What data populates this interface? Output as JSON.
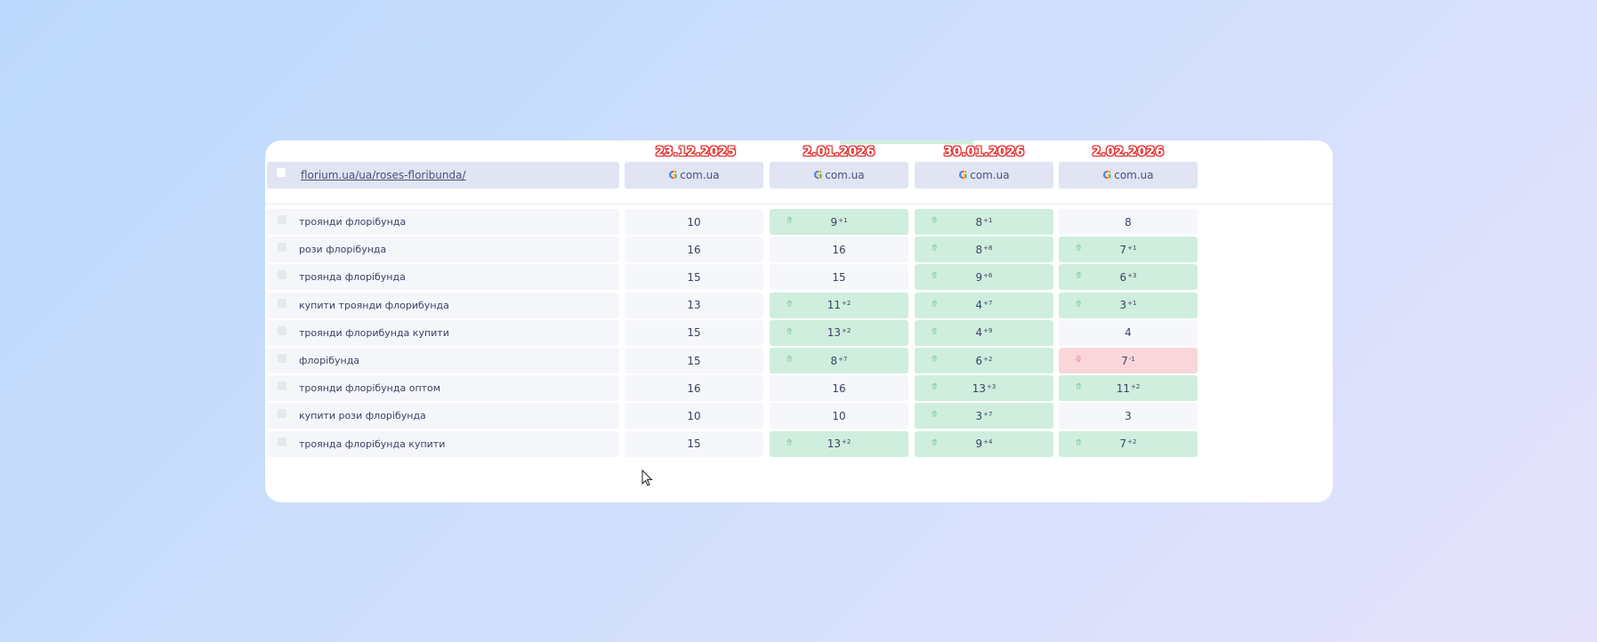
{
  "header": {
    "url": "florium.ua/ua/roses-floribunda/",
    "engine_label": "com.ua",
    "engine_icon": "google-icon"
  },
  "dates": [
    "23.12.2025",
    "2.01.2026",
    "30.01.2026",
    "2.02.2026"
  ],
  "columns": 4,
  "rows": [
    {
      "keyword": "троянди флорібунда",
      "cells": [
        {
          "value": "10",
          "delta": "",
          "trend": "none"
        },
        {
          "value": "9",
          "delta": "+1",
          "trend": "up"
        },
        {
          "value": "8",
          "delta": "+1",
          "trend": "up"
        },
        {
          "value": "8",
          "delta": "",
          "trend": "none"
        }
      ]
    },
    {
      "keyword": "рози флорібунда",
      "cells": [
        {
          "value": "16",
          "delta": "",
          "trend": "none"
        },
        {
          "value": "16",
          "delta": "",
          "trend": "none"
        },
        {
          "value": "8",
          "delta": "+8",
          "trend": "up"
        },
        {
          "value": "7",
          "delta": "+1",
          "trend": "up"
        }
      ]
    },
    {
      "keyword": "троянда флорібунда",
      "cells": [
        {
          "value": "15",
          "delta": "",
          "trend": "none"
        },
        {
          "value": "15",
          "delta": "",
          "trend": "none"
        },
        {
          "value": "9",
          "delta": "+6",
          "trend": "up"
        },
        {
          "value": "6",
          "delta": "+3",
          "trend": "up"
        }
      ]
    },
    {
      "keyword": "купити троянди флорибунда",
      "cells": [
        {
          "value": "13",
          "delta": "",
          "trend": "none"
        },
        {
          "value": "11",
          "delta": "+2",
          "trend": "up"
        },
        {
          "value": "4",
          "delta": "+7",
          "trend": "up"
        },
        {
          "value": "3",
          "delta": "+1",
          "trend": "up"
        }
      ]
    },
    {
      "keyword": "троянди флорибунда купити",
      "cells": [
        {
          "value": "15",
          "delta": "",
          "trend": "none"
        },
        {
          "value": "13",
          "delta": "+2",
          "trend": "up"
        },
        {
          "value": "4",
          "delta": "+9",
          "trend": "up"
        },
        {
          "value": "4",
          "delta": "",
          "trend": "none"
        }
      ]
    },
    {
      "keyword": "флорібунда",
      "cells": [
        {
          "value": "15",
          "delta": "",
          "trend": "none"
        },
        {
          "value": "8",
          "delta": "+7",
          "trend": "up"
        },
        {
          "value": "6",
          "delta": "+2",
          "trend": "up"
        },
        {
          "value": "7",
          "delta": "-1",
          "trend": "down"
        }
      ]
    },
    {
      "keyword": "троянди флорібунда оптом",
      "cells": [
        {
          "value": "16",
          "delta": "",
          "trend": "none"
        },
        {
          "value": "16",
          "delta": "",
          "trend": "none"
        },
        {
          "value": "13",
          "delta": "+3",
          "trend": "up"
        },
        {
          "value": "11",
          "delta": "+2",
          "trend": "up"
        }
      ]
    },
    {
      "keyword": "купити рози флорібунда",
      "cells": [
        {
          "value": "10",
          "delta": "",
          "trend": "none"
        },
        {
          "value": "10",
          "delta": "",
          "trend": "none"
        },
        {
          "value": "3",
          "delta": "+7",
          "trend": "up"
        },
        {
          "value": "3",
          "delta": "",
          "trend": "none"
        }
      ]
    },
    {
      "keyword": "троянда флорібунда купити",
      "cells": [
        {
          "value": "15",
          "delta": "",
          "trend": "none"
        },
        {
          "value": "13",
          "delta": "+2",
          "trend": "up"
        },
        {
          "value": "9",
          "delta": "+4",
          "trend": "up"
        },
        {
          "value": "7",
          "delta": "+2",
          "trend": "up"
        }
      ]
    }
  ],
  "colors": {
    "up": "#cfeedd",
    "down": "#f8d6da",
    "neutral": "#f6f7fa",
    "date_label": "#e12828"
  }
}
